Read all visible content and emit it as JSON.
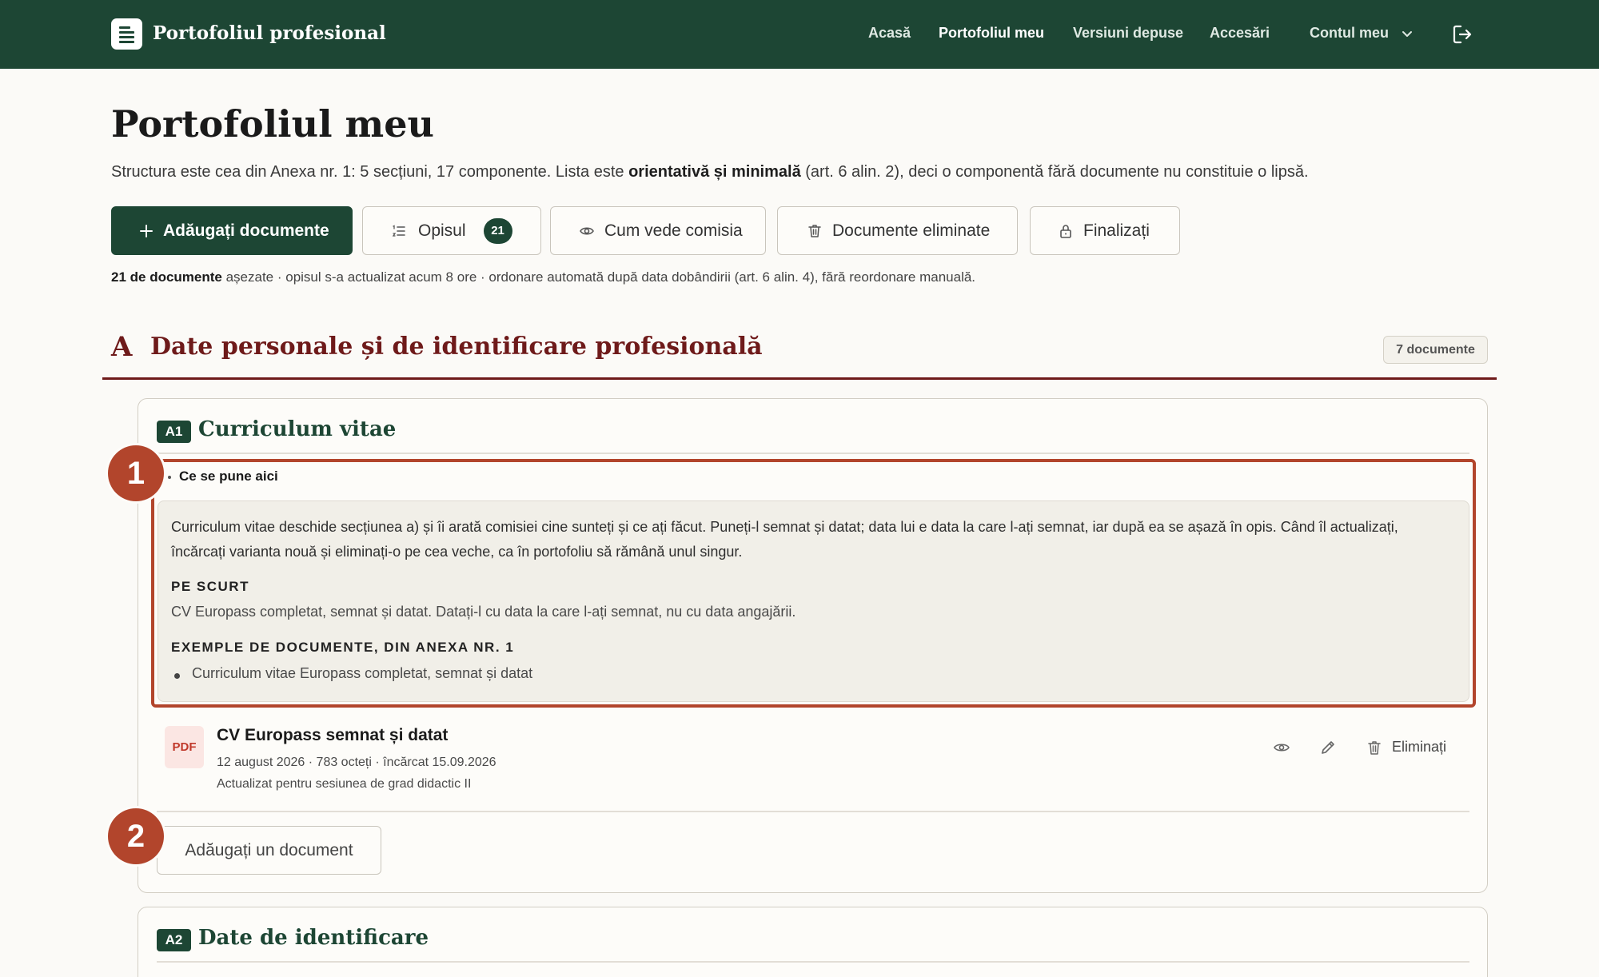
{
  "app": {
    "brand": "Portofoliul profesional",
    "nav": [
      "Acasă",
      "Portofoliul meu",
      "Versiuni depuse",
      "Accesări"
    ],
    "account": "Contul meu",
    "active_nav": "Portofoliul meu"
  },
  "header": {
    "title": "Portofoliul meu",
    "subtitle_pre": "Structura este cea din Anexa nr. 1: 5 secțiuni, 17 componente. Lista este ",
    "subtitle_bold": "orientativă și minimală",
    "subtitle_post": " (art. 6 alin. 2), deci o componentă fără documente nu constituie o lipsă."
  },
  "actions": {
    "add": "Adăugați documente",
    "opis": "Opisul",
    "opis_count": "21",
    "commission_view": "Cum vede comisia",
    "removed": "Documente eliminate",
    "finalize": "Finalizați"
  },
  "meta": {
    "count_bold": "21 de documente",
    "rest": " așezate · opisul s-a actualizat acum 8 ore · ordonare automată după data dobândirii (art. 6 alin. 4), fără reordonare manuală."
  },
  "section": {
    "letter": "A",
    "title": "Date personale și de identificare profesională",
    "count": "7 documente"
  },
  "component": {
    "code": "A1",
    "title": "Curriculum vitae",
    "help_label": "Ce se pune aici",
    "help_text": "Curriculum vitae deschide secțiunea a) și îi arată comisiei cine sunteți și ce ați făcut. Puneți-l semnat și datat; data lui e data la care l-ați semnat, iar după ea se așază în opis. Când îl actualizați, încărcați varianta nouă și eliminați-o pe cea veche, ca în portofoliu să rămână unul singur.",
    "short_heading": "PE SCURT",
    "short_text": "CV Europass completat, semnat și datat. Datați-l cu data la care l-ați semnat, nu cu data angajării.",
    "examples_heading": "EXEMPLE DE DOCUMENTE, DIN ANEXA NR. 1",
    "examples": [
      "Curriculum vitae Europass completat, semnat și datat"
    ],
    "add_document": "Adăugați un document"
  },
  "document": {
    "type": "PDF",
    "title": "CV Europass semnat și datat",
    "meta": "12 august 2026 · 783 octeți · încărcat 15.09.2026",
    "note": "Actualizat pentru sesiunea de grad didactic II",
    "delete": "Eliminați"
  },
  "component2": {
    "code": "A2",
    "title": "Date de identificare"
  },
  "markers": [
    "1",
    "2"
  ],
  "colors": {
    "brand": "#1d4634",
    "section": "#6e1a1a",
    "highlight": "#b2452c",
    "pdf": "#c0392b"
  },
  "icons": [
    "plus-icon",
    "list-icon",
    "eye-icon",
    "trash-icon",
    "lock-icon",
    "chevron-down-icon",
    "logout-icon",
    "pencil-icon",
    "document-logo-icon"
  ]
}
